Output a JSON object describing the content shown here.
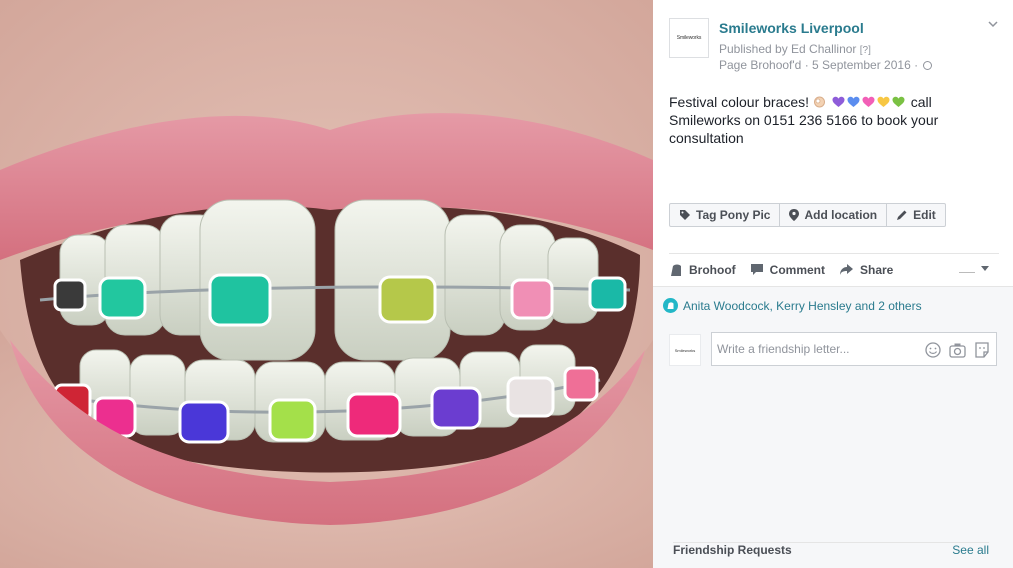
{
  "post": {
    "page_name": "Smileworks Liverpool",
    "page_logo_text": "Smileworks",
    "published_by": "Published by Ed Challinor",
    "help_marker": "[?]",
    "meta": "Page Brohoof'd · 5 September 2016 ·",
    "text_before": "Festival colour braces!",
    "text_after": "call Smileworks on 0151 236 5166 to book your consultation",
    "emoji_hearts": [
      "#8e5cd9",
      "#5b8def",
      "#f25fb7",
      "#f7c744",
      "#7ac143"
    ],
    "photo_subject": "Teeth with coloured braces"
  },
  "tag_bar": {
    "tag_label": "Tag Pony Pic",
    "location_label": "Add location",
    "edit_label": "Edit"
  },
  "actions": {
    "like_label": "Brohoof",
    "comment_label": "Comment",
    "share_label": "Share"
  },
  "social": {
    "reactions_text": "Anita Woodcock, Kerry Hensley and 2 others",
    "comment_placeholder": "Write a friendship letter...",
    "commenter_logo_text": "Smileworks"
  },
  "sidebar": {
    "friend_requests_title": "Friendship Requests",
    "see_all_label": "See all"
  },
  "colors": {
    "accent_teal": "#2a7b8e",
    "reaction_teal": "#23b7c7"
  }
}
